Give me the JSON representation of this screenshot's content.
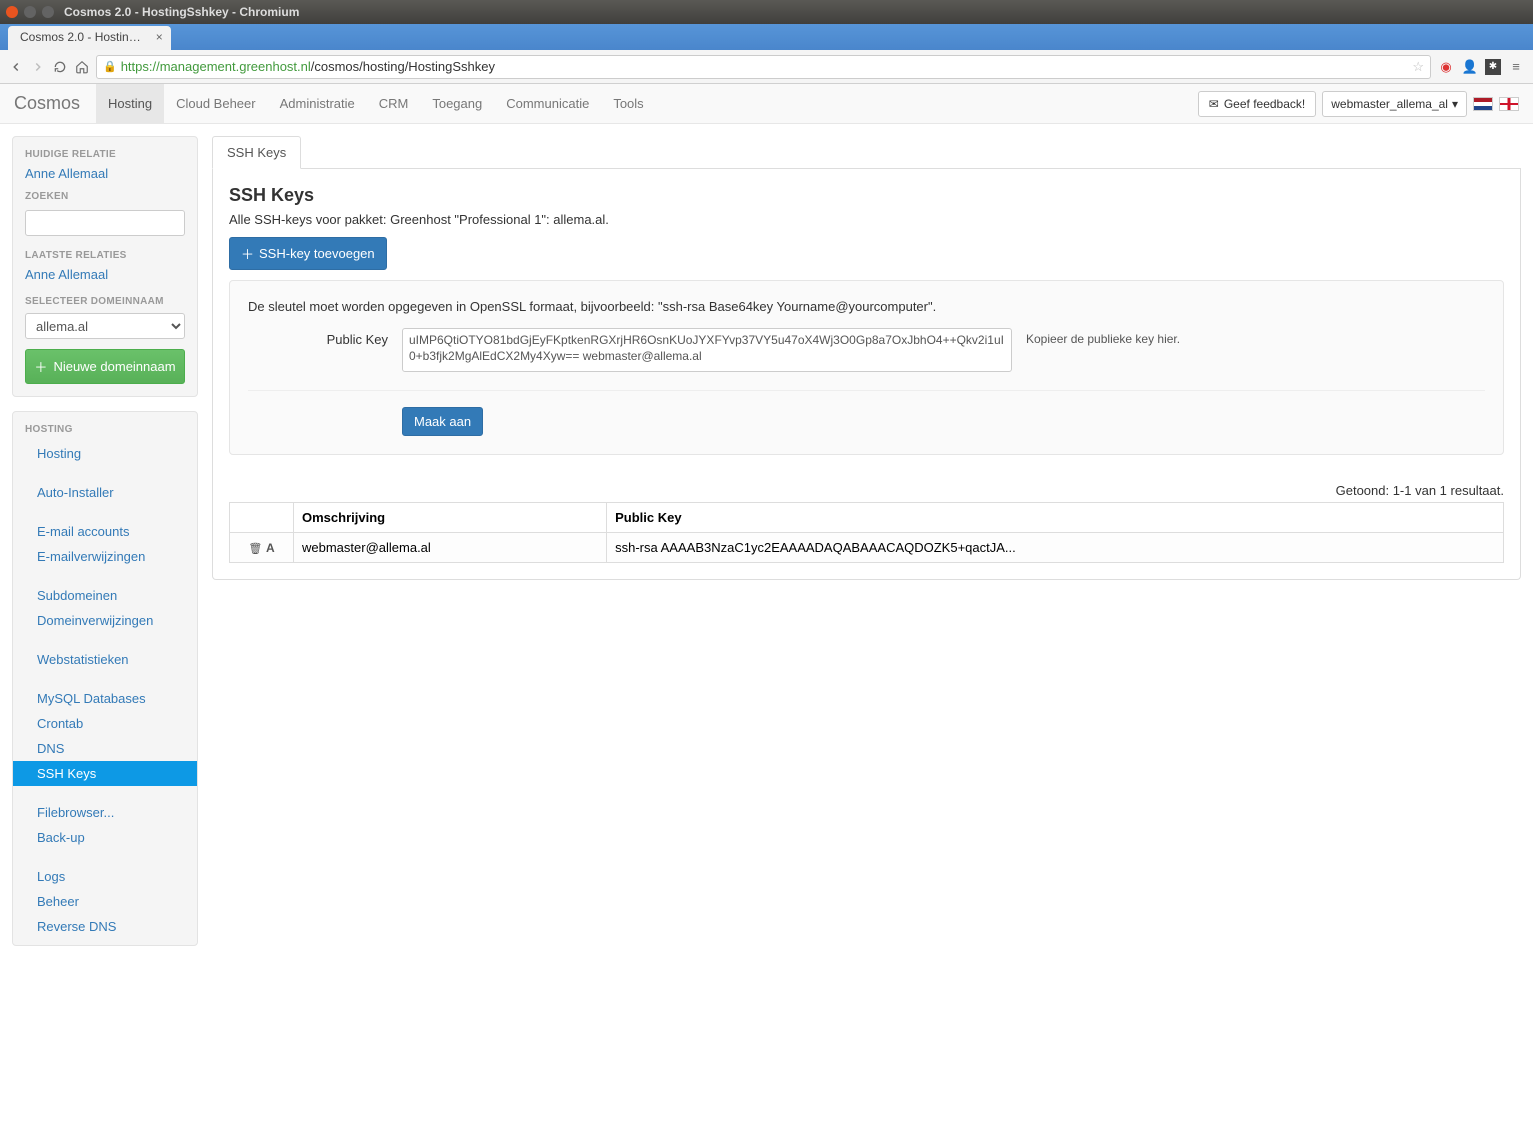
{
  "os": {
    "window_title": "Cosmos 2.0 - HostingSshkey - Chromium"
  },
  "browser": {
    "tab_title": "Cosmos 2.0 - Hostin…",
    "url_secure": "https://management.greenhost.nl",
    "url_path": "/cosmos/hosting/HostingSshkey"
  },
  "navbar": {
    "brand": "Cosmos",
    "items": [
      "Hosting",
      "Cloud Beheer",
      "Administratie",
      "CRM",
      "Toegang",
      "Communicatie",
      "Tools"
    ],
    "active_index": 0,
    "feedback": "Geef feedback!",
    "user": "webmaster_allema_al"
  },
  "sidebar": {
    "rel_heading": "HUIDIGE RELATIE",
    "rel_name": "Anne Allemaal",
    "search_heading": "ZOEKEN",
    "recent_heading": "LAATSTE RELATIES",
    "recent_name": "Anne Allemaal",
    "domain_heading": "SELECTEER DOMEINNAAM",
    "domain_selected": "allema.al",
    "new_domain": "Nieuwe domeinnaam",
    "hosting_heading": "HOSTING",
    "links": [
      "Hosting",
      "",
      "Auto-Installer",
      "",
      "E-mail accounts",
      "E-mailverwijzingen",
      "",
      "Subdomeinen",
      "Domeinverwijzingen",
      "",
      "Webstatistieken",
      "",
      "MySQL Databases",
      "Crontab",
      "DNS",
      "SSH Keys",
      "",
      "Filebrowser...",
      "Back-up",
      "",
      "Logs",
      "Beheer",
      "Reverse DNS"
    ],
    "active_link": "SSH Keys"
  },
  "page": {
    "tab": "SSH Keys",
    "title": "SSH Keys",
    "subtitle": "Alle SSH-keys voor pakket: Greenhost \"Professional 1\": allema.al.",
    "add_btn": "SSH-key toevoegen",
    "hint": "De sleutel moet worden opgegeven in OpenSSL formaat, bijvoorbeeld: \"ssh-rsa Base64key Yourname@yourcomputer\".",
    "label": "Public Key",
    "ta_value": "uIMP6QtiOTYO81bdGjEyFKptkenRGXrjHR6OsnKUoJYXFYvp37VY5u47oX4Wj3O0Gp8a7OxJbhO4++Qkv2i1uI0+b3fjk2MgAlEdCX2My4Xyw== webmaster@allema.al",
    "ta_help": "Kopieer de publieke key hier.",
    "submit": "Maak aan",
    "result_count": "Getoond: 1-1 van 1 resultaat.",
    "cols": [
      "Omschrijving",
      "Public Key"
    ],
    "rows": [
      {
        "desc": "webmaster@allema.al",
        "key": "ssh-rsa AAAAB3NzaC1yc2EAAAADAQABAAACAQDOZK5+qactJA..."
      }
    ]
  }
}
